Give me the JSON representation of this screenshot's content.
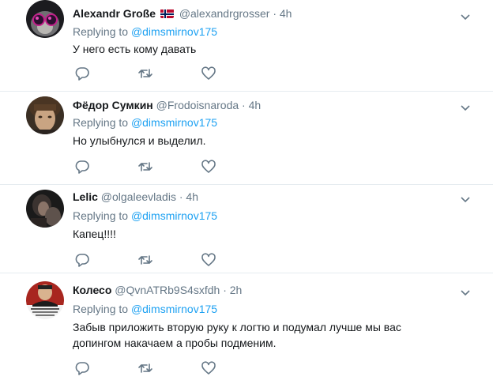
{
  "replying_to_label": "Replying to",
  "colors": {
    "link": "#1da1f2",
    "muted": "#657786",
    "text": "#14171a",
    "border": "#e6ecf0"
  },
  "icons": {
    "reply": "reply-icon",
    "retweet": "retweet-icon",
    "like": "heart-icon",
    "more": "chevron-down-icon"
  },
  "tweets": [
    {
      "name": "Alexandr Große",
      "handle": "@alexandrgrosser",
      "separator": "·",
      "time": "4h",
      "replying_to": "@dimsmirnov175",
      "text": "У него есть кому давать"
    },
    {
      "name": "Фёдор Сумкин",
      "handle": "@Frodoisnaroda",
      "separator": "·",
      "time": "4h",
      "replying_to": "@dimsmirnov175",
      "text": "Но улыбнулся и выделил."
    },
    {
      "name": "Lelic",
      "handle": "@olgaleevladis",
      "separator": "·",
      "time": "4h",
      "replying_to": "@dimsmirnov175",
      "text": "Капец!!!!"
    },
    {
      "name": "Колесо",
      "handle": "@QvnATRb9S4sxfdh",
      "separator": "·",
      "time": "2h",
      "replying_to": "@dimsmirnov175",
      "text": "Забыв приложить вторую руку к логтю и подумал лучше мы вас допингом накачаем а пробы подменим."
    }
  ]
}
